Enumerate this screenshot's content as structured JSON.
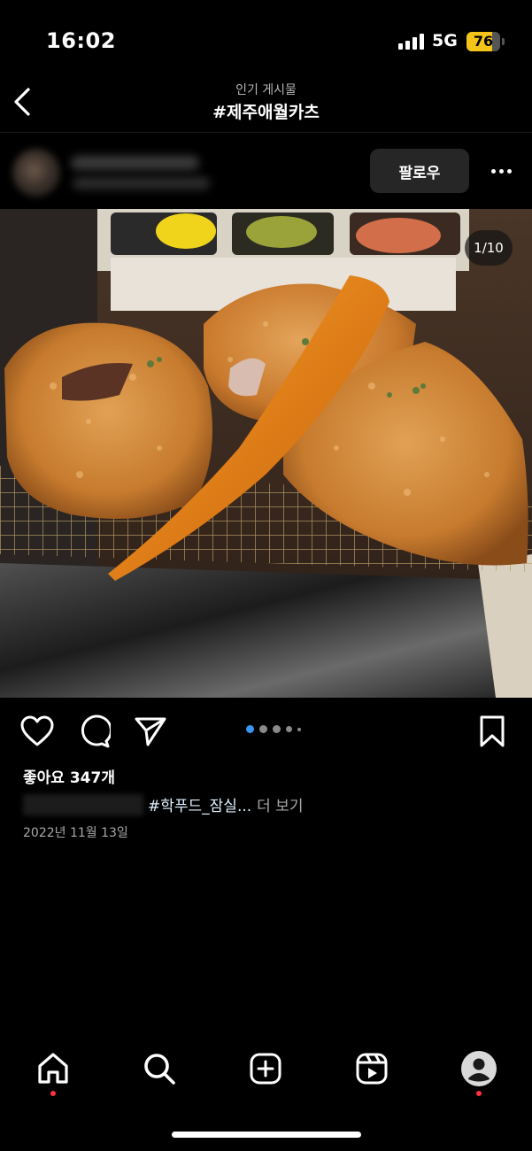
{
  "status": {
    "time": "16:02",
    "network": "5G",
    "battery": "76",
    "battery_level": 0.76,
    "battery_color": "#f4c518"
  },
  "header": {
    "subtitle": "인기 게시물",
    "title": "#제주애월카츠",
    "back_icon": "chevron-left-icon"
  },
  "post": {
    "follow_label": "팔로우",
    "more_icon": "ellipsis-icon",
    "image_counter": "1/10",
    "image_count": 10,
    "current_image": 1,
    "likes": "좋아요 347개",
    "caption_tag": "#학푸드_잠실...",
    "caption_more": "더 보기",
    "date": "2022년 11월 13일",
    "carousel_dots": 5,
    "active_dot_color": "#3897f0",
    "icons": [
      "heart-icon",
      "comment-icon",
      "share-icon",
      "bookmark-icon"
    ]
  },
  "nav": {
    "items": [
      "home-icon",
      "search-icon",
      "create-icon",
      "reels-icon",
      "profile-icon"
    ],
    "notification_color": "#ff3040"
  }
}
